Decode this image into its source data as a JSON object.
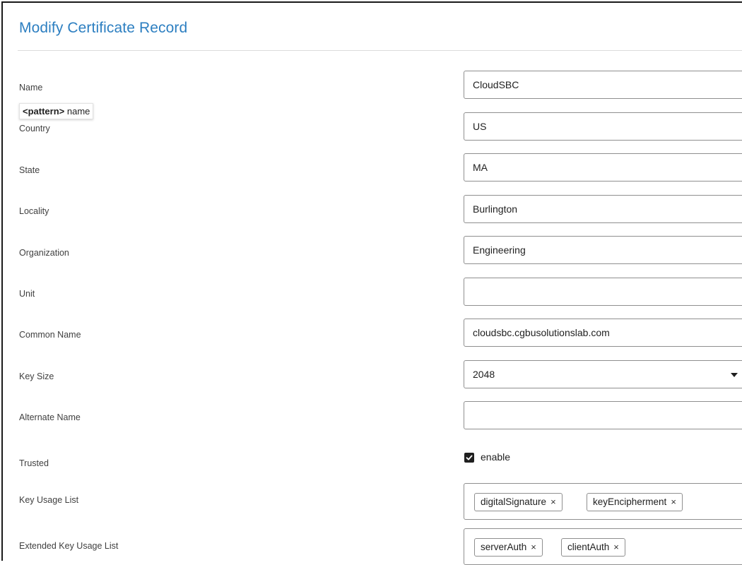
{
  "title": "Modify Certificate Record",
  "tooltip": {
    "pattern": "<pattern>",
    "text": " name"
  },
  "labels": {
    "name": "Name",
    "country": "Country",
    "state": "State",
    "locality": "Locality",
    "organization": "Organization",
    "unit": "Unit",
    "common_name": "Common Name",
    "key_size": "Key Size",
    "alternate_name": "Alternate Name",
    "trusted": "Trusted",
    "key_usage_list": "Key Usage List",
    "extended_key_usage_list": "Extended Key Usage List"
  },
  "values": {
    "name": "CloudSBC",
    "country": "US",
    "state": "MA",
    "locality": "Burlington",
    "organization": "Engineering",
    "unit": "",
    "common_name": "cloudsbc.cgbusolutionslab.com",
    "key_size": "2048",
    "alternate_name": "",
    "trusted_label": "enable",
    "trusted_checked": true
  },
  "key_usage": [
    "digitalSignature",
    "keyEncipherment"
  ],
  "extended_key_usage": [
    "serverAuth",
    "clientAuth"
  ],
  "chip_remove": "×",
  "colors": {
    "title": "#2d7fc1",
    "checkbox": "#1f1f1f"
  }
}
